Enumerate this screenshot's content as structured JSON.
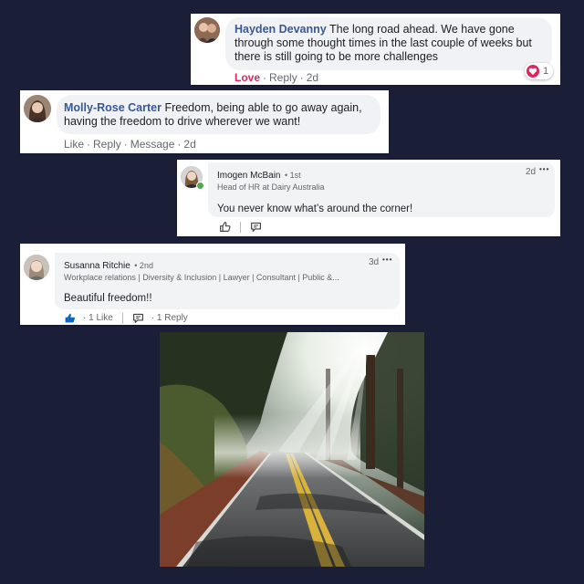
{
  "comments": {
    "hayden": {
      "name": "Hayden Devanny",
      "text": "The long road ahead. We have gone through some thought times in the last couple of weeks but there is still going to be more challenges",
      "like_label": "Love",
      "reply_label": "Reply",
      "time": "2d",
      "reaction_count": "1"
    },
    "molly": {
      "name": "Molly-Rose Carter",
      "text": "Freedom, being able to go away again, having the freedom to drive wherever we want!",
      "like_label": "Like",
      "reply_label": "Reply",
      "message_label": "Message",
      "time": "2d"
    },
    "imogen": {
      "name": "Imogen McBain",
      "degree": "• 1st",
      "headline": "Head of HR at Dairy Australia",
      "text": "You never know what’s around the corner!",
      "time": "2d",
      "more": "•••"
    },
    "susanna": {
      "name": "Susanna Ritchie",
      "degree": "• 2nd",
      "headline": "Workplace relations | Diversity & Inclusion | Lawyer | Consultant | Public &...",
      "text": "Beautiful freedom!!",
      "time": "3d",
      "more": "•••",
      "likes_label": "· 1 Like",
      "replies_label": "· 1 Reply"
    }
  },
  "colors": {
    "background": "#1b1e37",
    "facebook_link": "#385898",
    "love_red": "#e0245e",
    "linkedin_blue": "#0a66c2"
  },
  "icons": [
    "love-reaction-icon",
    "thumbs-up-icon",
    "comment-icon",
    "more-icon",
    "online-status-icon"
  ]
}
